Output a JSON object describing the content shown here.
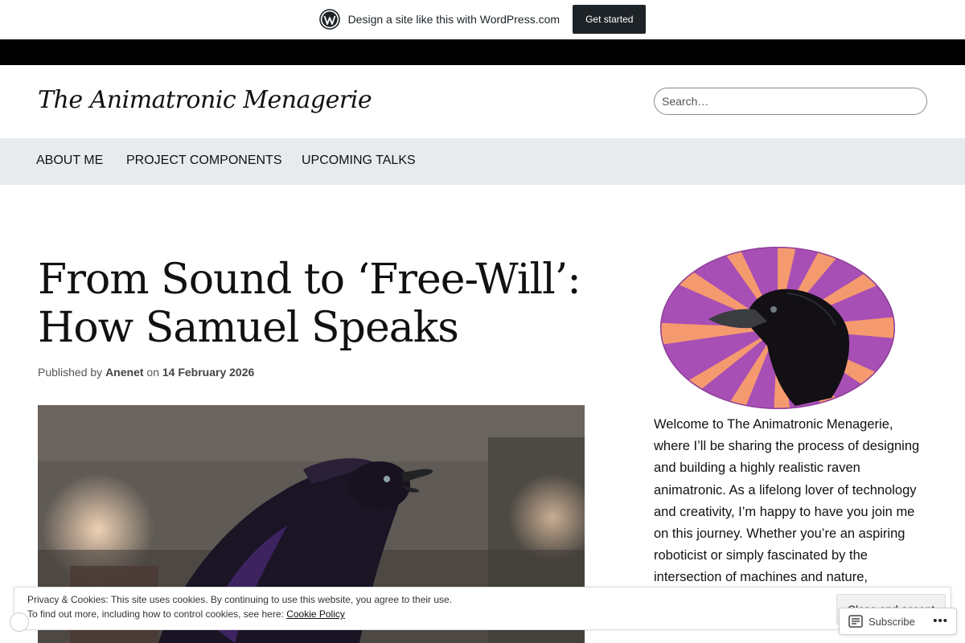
{
  "promo": {
    "text": "Design a site like this with WordPress.com",
    "button": "Get started"
  },
  "site": {
    "title": "The Animatronic Menagerie",
    "search_placeholder": "Search…"
  },
  "nav": {
    "items": [
      {
        "label": "ABOUT ME"
      },
      {
        "label": "PROJECT COMPONENTS"
      },
      {
        "label": "UPCOMING TALKS"
      }
    ]
  },
  "post": {
    "title_line1": "From Sound to ‘Free-Will’:",
    "title_line2": "How Samuel Speaks",
    "meta_prefix": "Published by",
    "author": "Anenet",
    "meta_on": "on",
    "date": "14 February 2026"
  },
  "sidebar": {
    "intro": "Welcome to The Animatronic Menagerie, where I’ll be sharing the process of designing and building a highly realistic raven animatronic. As a lifelong lover of technology and creativity, I’m happy to have you join me on this journey. Whether you’re an aspiring roboticist or simply fascinated by the intersection of machines and nature,"
  },
  "cookie": {
    "line1": "Privacy & Cookies: This site uses cookies. By continuing to use this website, you agree to their use.",
    "line2_prefix": "To find out more, including how to control cookies, see here:",
    "link": "Cookie Policy",
    "button": "Close and accept"
  },
  "subscribe": {
    "label": "Subscribe",
    "icon": "subscribe-reader-icon",
    "more_icon": "more-options-icon"
  },
  "colors": {
    "nav_bg": "#e8ebee",
    "promo_button": "#1d2327",
    "sunburst_purple": "#a84fb5",
    "sunburst_orange": "#f59a6f"
  }
}
